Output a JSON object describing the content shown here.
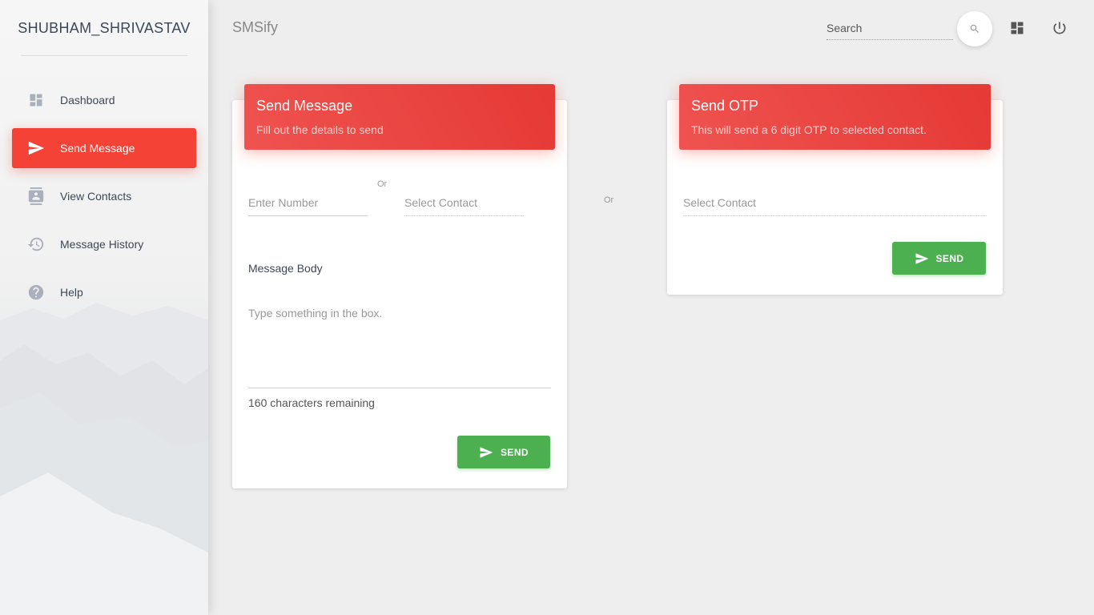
{
  "sidebar": {
    "brand": "SHUBHAM_SHRIVASTAV",
    "items": [
      {
        "label": "Dashboard",
        "icon": "dashboard-icon",
        "active": false
      },
      {
        "label": "Send Message",
        "icon": "send-icon",
        "active": true
      },
      {
        "label": "View Contacts",
        "icon": "contacts-icon",
        "active": false
      },
      {
        "label": "Message History",
        "icon": "history-icon",
        "active": false
      },
      {
        "label": "Help",
        "icon": "help-icon",
        "active": false
      }
    ]
  },
  "header": {
    "app_name": "SMSify",
    "search_placeholder": "Search",
    "icons": [
      "search-icon",
      "dashboard-icon",
      "power-icon"
    ]
  },
  "send_message_card": {
    "title": "Send Message",
    "subtitle": "Fill out the details to send",
    "number_placeholder": "Enter Number",
    "or_label": "Or",
    "contact_placeholder": "Select Contact",
    "body_label": "Message Body",
    "body_placeholder": "Type something in the box.",
    "remaining": "160 characters remaining",
    "send_label": "SEND"
  },
  "between_or": "Or",
  "send_otp_card": {
    "title": "Send OTP",
    "subtitle": "This will send a 6 digit OTP to selected contact.",
    "contact_placeholder": "Select Contact",
    "send_label": "SEND"
  },
  "colors": {
    "accent": "#f44336",
    "header_gradient_start": "#ef5350",
    "header_gradient_end": "#e53935",
    "success": "#4caf50",
    "background": "#eeeeee",
    "text": "#3c4858"
  }
}
